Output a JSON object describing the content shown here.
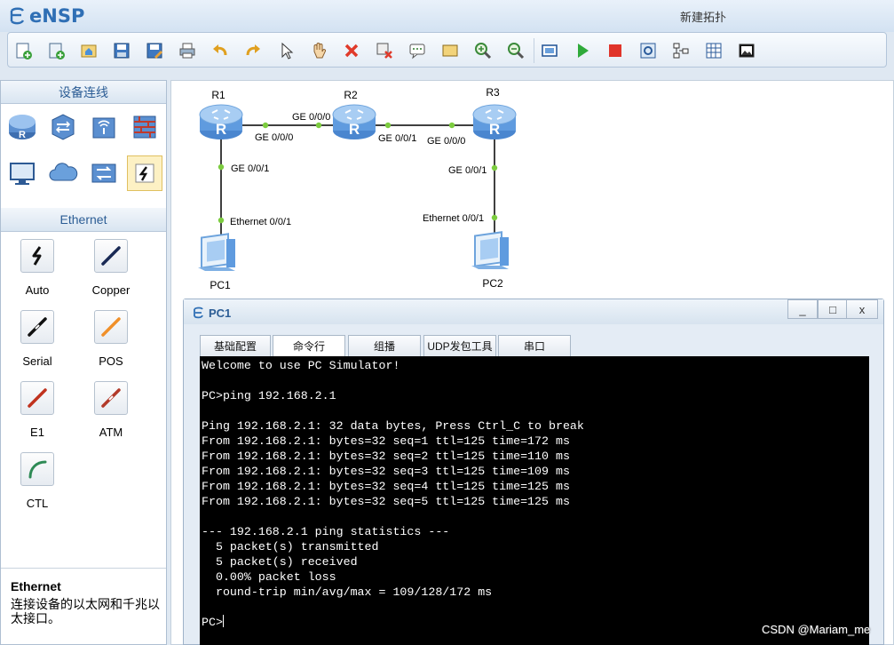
{
  "app": {
    "name": "eNSP",
    "window_title": "新建拓扑"
  },
  "toolbar": {
    "buttons": [
      "new-topology-icon",
      "new-example-icon",
      "open-icon",
      "save-icon",
      "save-as-icon",
      "print-icon",
      "undo-icon",
      "redo-icon",
      "select-pointer-icon",
      "pan-hand-icon",
      "delete-icon",
      "delete-link-icon",
      "text-note-icon",
      "rectangle-icon",
      "zoom-in-icon",
      "zoom-out-icon",
      "adapt-view-icon",
      "start-device-icon",
      "stop-device-icon",
      "capture-icon",
      "topology-icon",
      "grid-icon",
      "screenshot-icon"
    ]
  },
  "devices_panel": {
    "title": "设备连线",
    "items": [
      "router-icon",
      "switch-icon",
      "wireless-icon",
      "firewall-icon",
      "pc-icon",
      "cloud-icon",
      "hub-icon",
      "connection-icon"
    ]
  },
  "cables_panel": {
    "title": "Ethernet",
    "items": [
      {
        "label": "Auto",
        "icon": "auto-cable-icon",
        "color": "#111111"
      },
      {
        "label": "Copper",
        "icon": "copper-cable-icon",
        "color": "#1a2a55"
      },
      {
        "label": "Serial",
        "icon": "serial-cable-icon",
        "color": "#111111"
      },
      {
        "label": "POS",
        "icon": "pos-cable-icon",
        "color": "#f0902a"
      },
      {
        "label": "E1",
        "icon": "e1-cable-icon",
        "color": "#c0321e"
      },
      {
        "label": "ATM",
        "icon": "atm-cable-icon",
        "color": "#b23a2a"
      },
      {
        "label": "CTL",
        "icon": "ctl-cable-icon",
        "color": "#2e8a55"
      }
    ],
    "info_title": "Ethernet",
    "info_desc": "连接设备的以太网和千兆以太接口。"
  },
  "topology": {
    "nodes": [
      {
        "name": "R1",
        "type": "router"
      },
      {
        "name": "R2",
        "type": "router"
      },
      {
        "name": "R3",
        "type": "router"
      },
      {
        "name": "PC1",
        "type": "pc"
      },
      {
        "name": "PC2",
        "type": "pc"
      }
    ],
    "ports": {
      "r1_r2_r1": "GE 0/0/0",
      "r1_r2_r2": "GE 0/0/0",
      "r2_r3_r2": "GE 0/0/1",
      "r2_r3_r3": "GE 0/0/0",
      "r1_pc1_r1": "GE 0/0/1",
      "r1_pc1_pc": "Ethernet 0/0/1",
      "r3_pc2_r3": "GE 0/0/1",
      "r3_pc2_pc": "Ethernet 0/0/1"
    },
    "link_color": "#000000",
    "port_dot_color": "#7ccc3f"
  },
  "pc_window": {
    "title": "PC1",
    "controls": {
      "minimize": "_",
      "maximize": "□",
      "close": "x"
    },
    "tabs": [
      "基础配置",
      "命令行",
      "组播",
      "UDP发包工具",
      "串口"
    ],
    "active_tab": "命令行",
    "terminal_lines": [
      "Welcome to use PC Simulator!",
      "",
      "PC>ping 192.168.2.1",
      "",
      "Ping 192.168.2.1: 32 data bytes, Press Ctrl_C to break",
      "From 192.168.2.1: bytes=32 seq=1 ttl=125 time=172 ms",
      "From 192.168.2.1: bytes=32 seq=2 ttl=125 time=110 ms",
      "From 192.168.2.1: bytes=32 seq=3 ttl=125 time=109 ms",
      "From 192.168.2.1: bytes=32 seq=4 ttl=125 time=125 ms",
      "From 192.168.2.1: bytes=32 seq=5 ttl=125 time=125 ms",
      "",
      "--- 192.168.2.1 ping statistics ---",
      "  5 packet(s) transmitted",
      "  5 packet(s) received",
      "  0.00% packet loss",
      "  round-trip min/avg/max = 109/128/172 ms",
      "",
      "PC>"
    ]
  },
  "watermark": "CSDN @Mariam_me"
}
